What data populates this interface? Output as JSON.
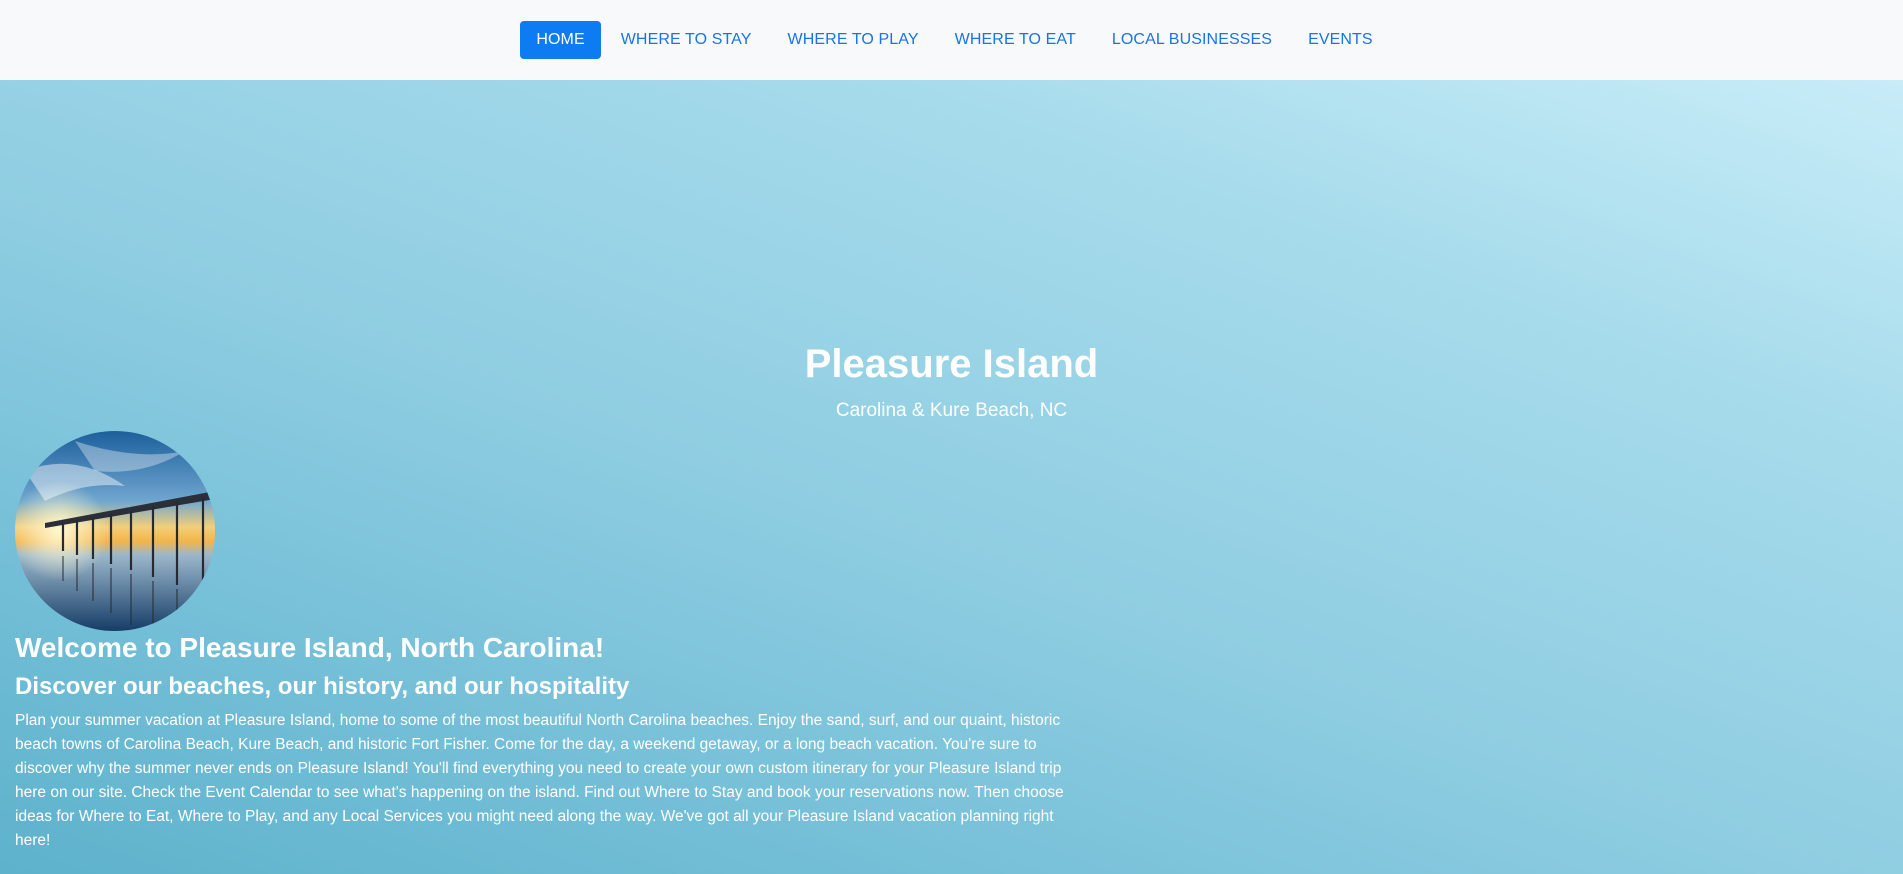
{
  "nav": {
    "items": [
      {
        "label": "HOME",
        "active": true
      },
      {
        "label": "WHERE TO STAY",
        "active": false
      },
      {
        "label": "WHERE TO PLAY",
        "active": false
      },
      {
        "label": "WHERE TO EAT",
        "active": false
      },
      {
        "label": "LOCAL BUSINESSES",
        "active": false
      },
      {
        "label": "EVENTS",
        "active": false
      }
    ],
    "colors": {
      "link": "#1a73e8",
      "active_bg": "#0d7bf2"
    }
  },
  "hero": {
    "title": "Pleasure Island",
    "subtitle": "Carolina & Kure Beach, NC"
  },
  "main": {
    "heading": "Welcome to Pleasure Island, North Carolina!",
    "subheading": "Discover our beaches, our history, and our hospitality",
    "paragraph": "Plan your summer vacation at Pleasure Island, home to some of the most beautiful North Carolina beaches. Enjoy the sand, surf, and our quaint, historic beach towns of Carolina Beach, Kure Beach, and historic Fort Fisher. Come for the day, a weekend getaway, or a long beach vacation. You're sure to discover why the summer never ends on Pleasure Island! You'll find everything you need to create your own custom itinerary for your Pleasure Island trip here on our site. Check the Event Calendar to see what's happening on the island. Find out Where to Stay and book your reservations now. Then choose ideas for Where to Eat, Where to Play, and any Local Services you might need along the way. We've got all your Pleasure Island vacation planning right here!"
  }
}
